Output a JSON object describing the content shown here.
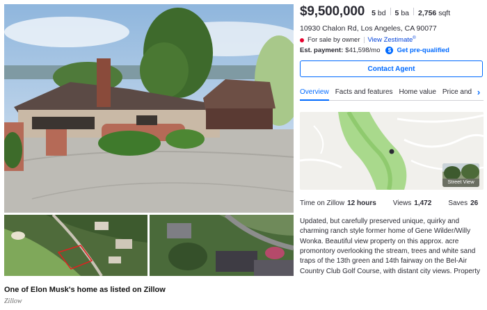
{
  "listing": {
    "price": "$9,500,000",
    "beds_value": "5",
    "beds_unit": "bd",
    "baths_value": "5",
    "baths_unit": "ba",
    "sqft_value": "2,756",
    "sqft_unit": "sqft",
    "address": "10930 Chalon Rd, Los Angeles, CA 90077",
    "status": "For sale by owner",
    "status_color": "#e6002d",
    "zestimate_link": "View Zestimate",
    "zestimate_mark": "®",
    "payment_label": "Est. payment:",
    "payment_value": "$41,598/mo",
    "prequal_icon": "dollar-circle-icon",
    "prequal_icon_glyph": "$",
    "prequal_label": "Get pre-qualified",
    "contact_button": "Contact Agent"
  },
  "tabs": [
    {
      "label": "Overview",
      "active": true
    },
    {
      "label": "Facts and features",
      "active": false
    },
    {
      "label": "Home value",
      "active": false
    },
    {
      "label": "Price and tax history",
      "active": false
    }
  ],
  "tabs_more_icon": "chevron-right-icon",
  "tabs_more_glyph": "›",
  "map": {
    "street_view_label": "Street View"
  },
  "stats": {
    "time_label": "Time on Zillow",
    "time_value": "12 hours",
    "views_label": "Views",
    "views_value": "1,472",
    "saves_label": "Saves",
    "saves_value": "26"
  },
  "description": "Updated, but carefully preserved unique, quirky and charming ranch style former home of Gene Wilder/Willy Wonka. Beautiful view property on this approx. acre promontory overlooking the stream, trees and white sand traps of the 13th green and 14th fairway on the Bel-Air Country Club Golf Course, with distant city views. Property includes approx.",
  "caption": "One of Elon Musk's home as listed on Zillow",
  "credit": "Zillow",
  "colors": {
    "accent": "#006aff",
    "text": "#2a2a33"
  }
}
